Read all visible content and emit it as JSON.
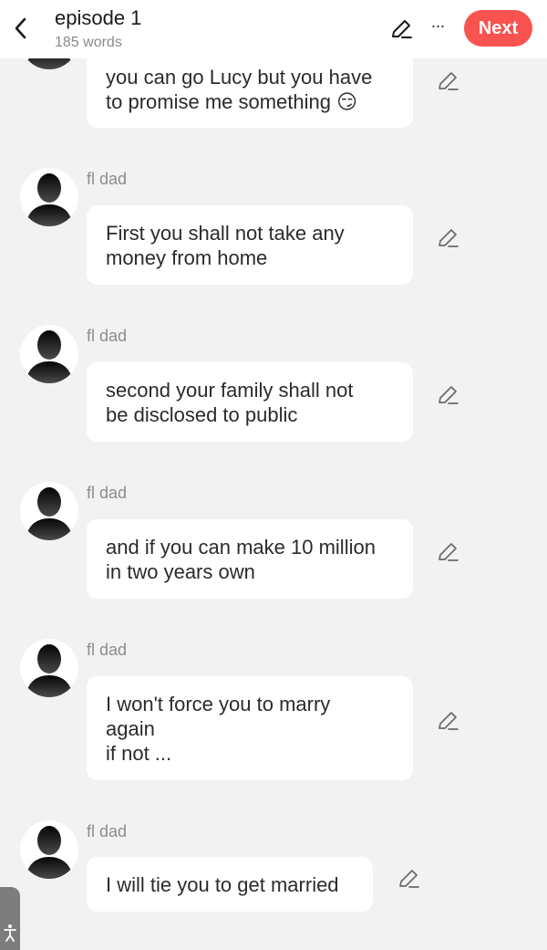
{
  "header": {
    "title": "episode 1",
    "word_count": "185 words",
    "next_label": "Next",
    "more_label": "···",
    "accent_color": "#f8534f"
  },
  "messages": [
    {
      "speaker": "",
      "text": "you  can go Lucy but you have\nto promise me something 😏"
    },
    {
      "speaker": "fl dad",
      "text": "First  you shall not take any\nmoney from home"
    },
    {
      "speaker": "fl dad",
      "text": "second  your family shall not\nbe disclosed to public"
    },
    {
      "speaker": "fl dad",
      "text": "and if you can make 10 million\nin two years own"
    },
    {
      "speaker": "fl dad",
      "text": "I won't force you to marry\nagain\nif not ..."
    },
    {
      "speaker": "fl dad",
      "text": "I will tie you to get married"
    }
  ],
  "icons": {
    "back": "chevron-left-icon",
    "edit": "pencil-icon",
    "more": "ellipsis-icon",
    "avatar": "person-silhouette-icon",
    "accessibility": "accessibility-icon"
  }
}
